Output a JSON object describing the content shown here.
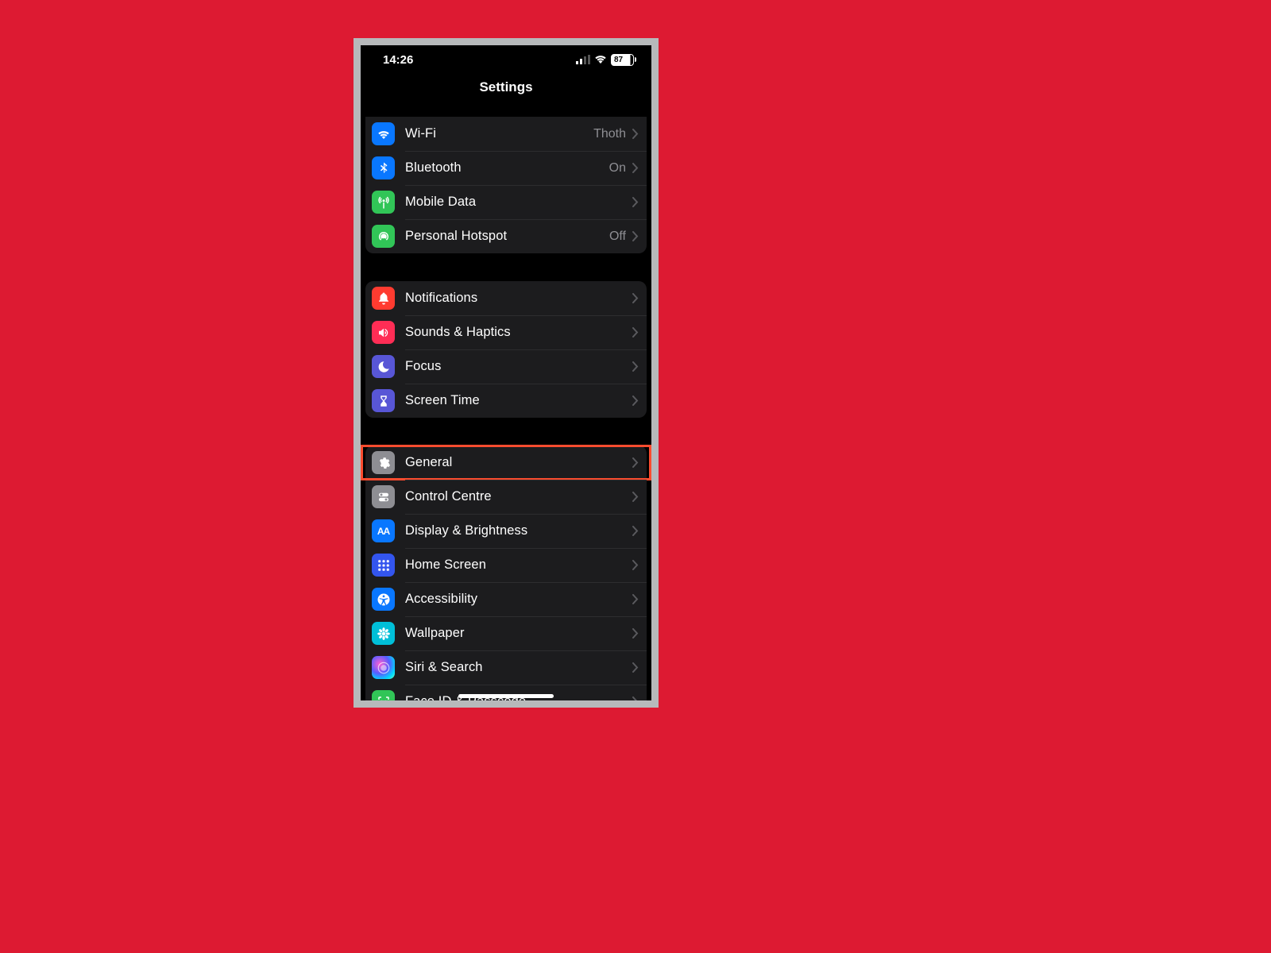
{
  "status": {
    "time": "14:26",
    "battery": "87"
  },
  "nav": {
    "title": "Settings"
  },
  "groups": [
    {
      "id": "connectivity",
      "rows": [
        {
          "id": "wifi",
          "label": "Wi-Fi",
          "value": "Thoth",
          "icon": "wifi-icon",
          "color": "#0977ff"
        },
        {
          "id": "bluetooth",
          "label": "Bluetooth",
          "value": "On",
          "icon": "bluetooth-icon",
          "color": "#0977ff"
        },
        {
          "id": "mobile-data",
          "label": "Mobile Data",
          "value": "",
          "icon": "antenna-icon",
          "color": "#31c557"
        },
        {
          "id": "personal-hotspot",
          "label": "Personal Hotspot",
          "value": "Off",
          "icon": "hotspot-icon",
          "color": "#31c557"
        }
      ]
    },
    {
      "id": "attention",
      "rows": [
        {
          "id": "notifications",
          "label": "Notifications",
          "value": "",
          "icon": "bell-icon",
          "color": "#ff3b30"
        },
        {
          "id": "sounds-haptics",
          "label": "Sounds & Haptics",
          "value": "",
          "icon": "speaker-icon",
          "color": "#ff2d55"
        },
        {
          "id": "focus",
          "label": "Focus",
          "value": "",
          "icon": "moon-icon",
          "color": "#5856d6"
        },
        {
          "id": "screen-time",
          "label": "Screen Time",
          "value": "",
          "icon": "hourglass-icon",
          "color": "#5856d6"
        }
      ]
    },
    {
      "id": "system",
      "rows": [
        {
          "id": "general",
          "label": "General",
          "value": "",
          "icon": "gear-icon",
          "color": "#8e8e93",
          "highlighted": true
        },
        {
          "id": "control-centre",
          "label": "Control Centre",
          "value": "",
          "icon": "switches-icon",
          "color": "#8e8e93"
        },
        {
          "id": "display-brightness",
          "label": "Display & Brightness",
          "value": "",
          "icon": "aa-icon",
          "color": "#0977ff"
        },
        {
          "id": "home-screen",
          "label": "Home Screen",
          "value": "",
          "icon": "grid-icon",
          "color": "#3355ee"
        },
        {
          "id": "accessibility",
          "label": "Accessibility",
          "value": "",
          "icon": "accessibility-icon",
          "color": "#0977ff"
        },
        {
          "id": "wallpaper",
          "label": "Wallpaper",
          "value": "",
          "icon": "flower-icon",
          "color": "#00bfd8"
        },
        {
          "id": "siri-search",
          "label": "Siri & Search",
          "value": "",
          "icon": "siri-icon",
          "color": "siri"
        },
        {
          "id": "faceid-passcode",
          "label": "Face ID & Passcode",
          "value": "",
          "icon": "faceid-icon",
          "color": "#31c557"
        }
      ]
    }
  ]
}
